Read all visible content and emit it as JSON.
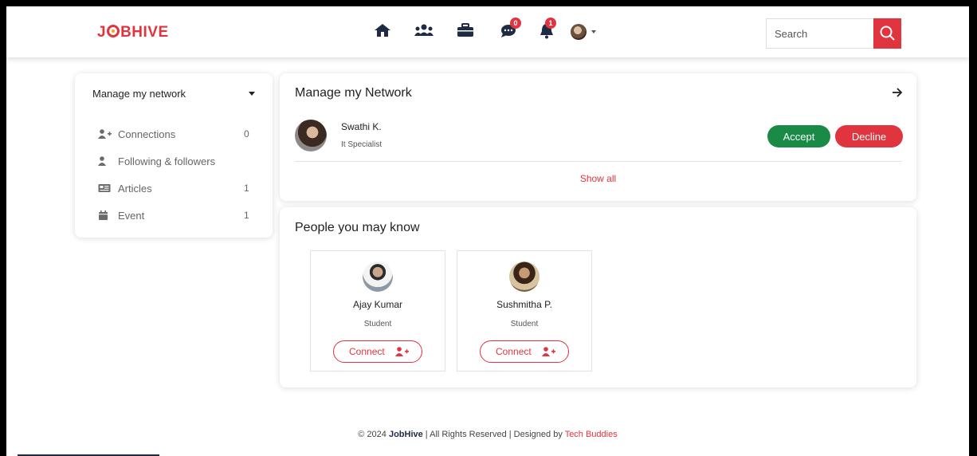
{
  "brand": {
    "name_pre": "J",
    "name_post": "BHIVE",
    "accent_color": "#e0343e"
  },
  "nav": {
    "icons": [
      "home-icon",
      "users-icon",
      "briefcase-icon",
      "chat-icon",
      "bell-icon"
    ],
    "messages_badge": "0",
    "notifications_badge": "1",
    "search_placeholder": "Search"
  },
  "sidebar": {
    "title": "Manage my network",
    "items": [
      {
        "label": "Connections",
        "count": "0",
        "icon": "user-plus-icon"
      },
      {
        "label": "Following & followers",
        "count": "",
        "icon": "user-icon"
      },
      {
        "label": "Articles",
        "count": "1",
        "icon": "newspaper-icon"
      },
      {
        "label": "Event",
        "count": "1",
        "icon": "calendar-icon"
      }
    ]
  },
  "network": {
    "title": "Manage my Network",
    "request": {
      "name": "Swathi K.",
      "role": "It Specialist"
    },
    "accept_label": "Accept",
    "decline_label": "Decline",
    "show_all_label": "Show all"
  },
  "pymk": {
    "title": "People you may know",
    "people": [
      {
        "name": "Ajay Kumar",
        "role": "Student"
      },
      {
        "name": "Sushmitha P.",
        "role": "Student"
      }
    ],
    "connect_label": "Connect"
  },
  "footer": {
    "copyright": "© 2024 ",
    "brand": "JobHive",
    "rights": " | All Rights Reserved | Designed by ",
    "designer": "Tech Buddies"
  }
}
